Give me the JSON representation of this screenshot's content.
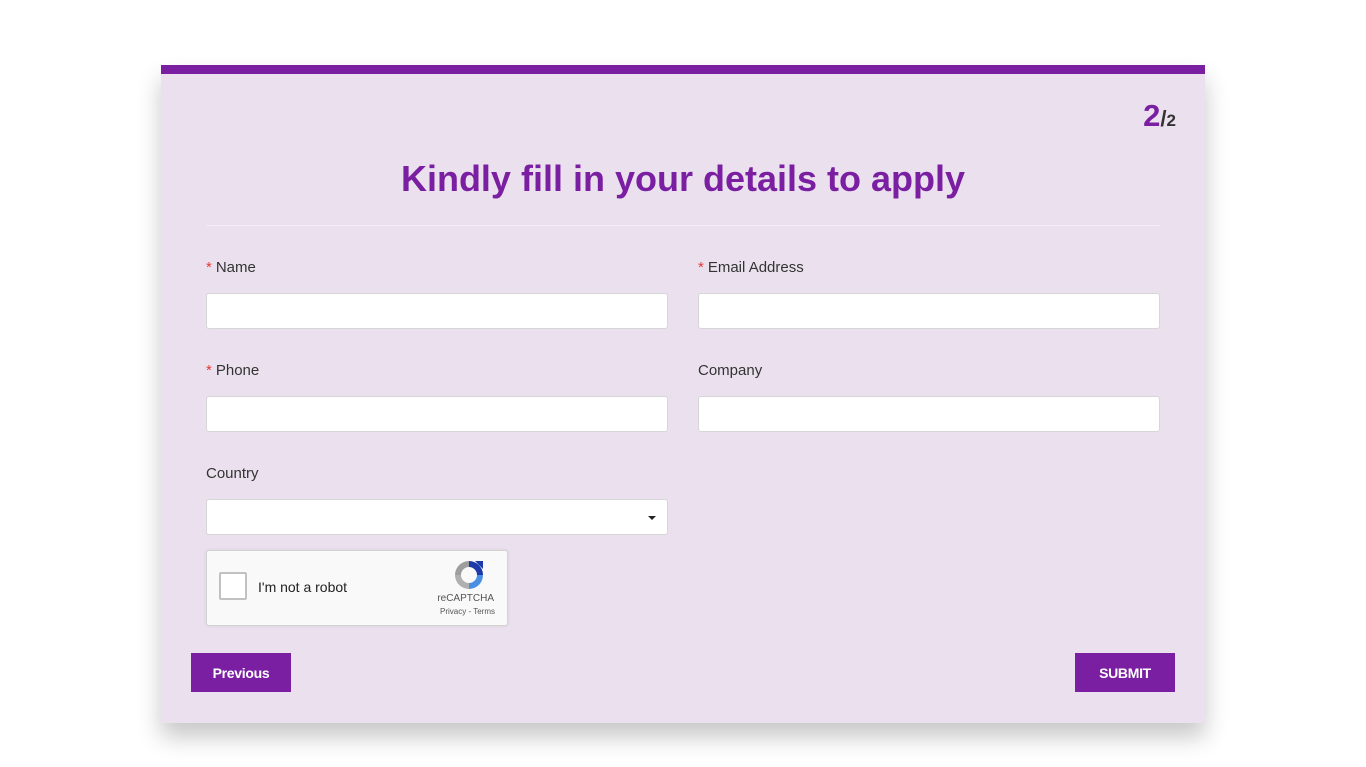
{
  "form": {
    "step_current": "2",
    "step_separator": "/",
    "step_total": "2",
    "title": "Kindly fill in your details to apply",
    "required_mark": "*",
    "fields": {
      "name": {
        "label": "Name",
        "value": ""
      },
      "email": {
        "label": "Email Address",
        "value": ""
      },
      "phone": {
        "label": "Phone",
        "value": ""
      },
      "company": {
        "label": "Company",
        "value": ""
      },
      "country": {
        "label": "Country",
        "selected": ""
      }
    },
    "recaptcha": {
      "checkbox_label": "I'm not a robot",
      "brand": "reCAPTCHA",
      "links": "Privacy - Terms"
    },
    "buttons": {
      "previous": "Previous",
      "submit": "SUBMIT"
    }
  },
  "colors": {
    "accent": "#7b1fa2",
    "card_background": "#ebe1ee",
    "required": "#e53935"
  }
}
